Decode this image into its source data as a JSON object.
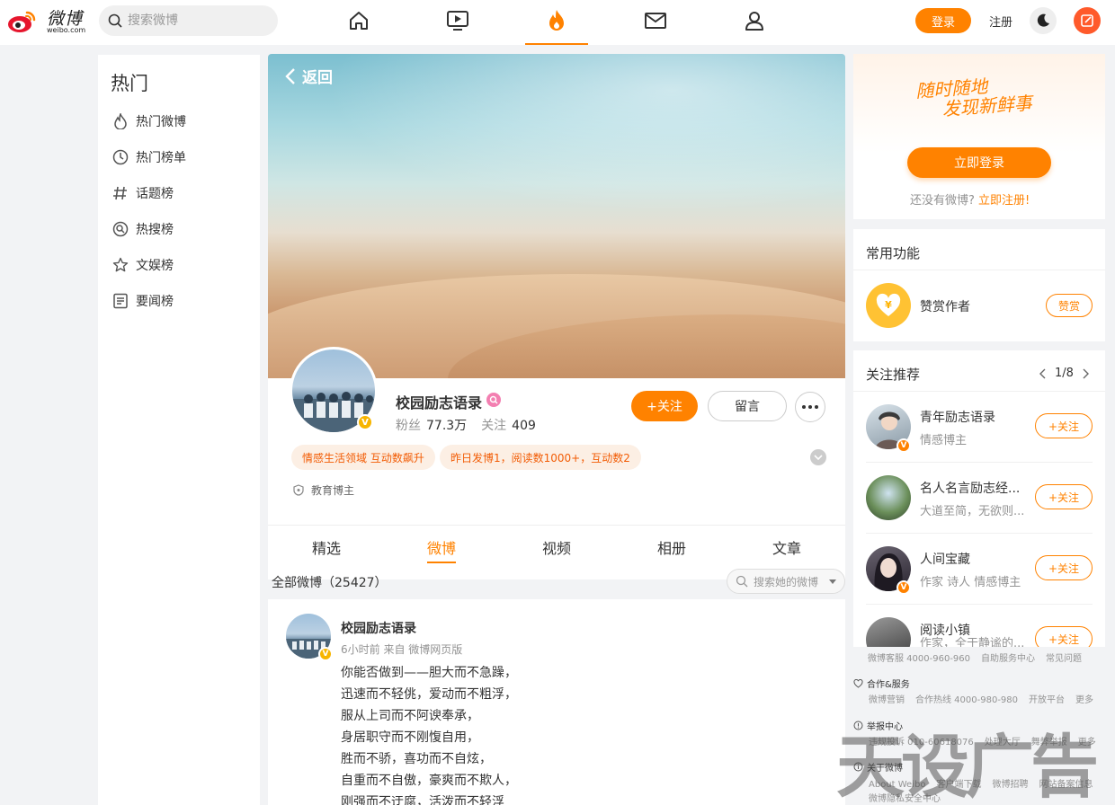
{
  "logo": {
    "name": "微博",
    "sub": "weibo.com"
  },
  "search": {
    "placeholder": "搜索微博"
  },
  "top_nav": [
    "home-icon",
    "video-icon",
    "hot-fire-icon",
    "message-icon",
    "user-icon"
  ],
  "header": {
    "login": "登录",
    "register": "注册"
  },
  "left_nav": {
    "title": "热门",
    "items": [
      {
        "label": "热门微博",
        "icon": "fire-icon"
      },
      {
        "label": "热门榜单",
        "icon": "clock-icon"
      },
      {
        "label": "话题榜",
        "icon": "hashtag-icon"
      },
      {
        "label": "热搜榜",
        "icon": "search-rank-icon"
      },
      {
        "label": "文娱榜",
        "icon": "star-icon"
      },
      {
        "label": "要闻榜",
        "icon": "news-icon"
      }
    ]
  },
  "profile": {
    "back": "返回",
    "name": "校园励志语录",
    "fans_label": "粉丝",
    "fans": "77.3万",
    "follow_label": "关注",
    "follow": "409",
    "follow_btn": "+关注",
    "message_btn": "留言",
    "tags": [
      "情感生活领域 互动数飙升",
      "昨日发博1，阅读数1000+，互动数2"
    ],
    "edu": "教育博主",
    "verify_badge": "V"
  },
  "tabs": [
    "精选",
    "微博",
    "视频",
    "相册",
    "文章"
  ],
  "active_tab": "微博",
  "feed": {
    "count_label": "全部微博（25427）",
    "search_placeholder": "搜索她的微博"
  },
  "post": {
    "name": "校园励志语录",
    "meta": "6小时前 来自 微博网页版",
    "lines": [
      "你能否做到——胆大而不急躁，",
      "迅速而不轻佻，爱动而不粗浮，",
      "服从上司而不阿谀奉承，",
      "身居职守而不刚愎自用，",
      "胜而不骄，喜功而不自炫，",
      "自重而不自傲，豪爽而不欺人，",
      "刚强而不迂腐，活泼而不轻浮"
    ]
  },
  "login_card": {
    "slogan_1": "随时随地",
    "slogan_2": "发现新鲜事",
    "login_now": "立即登录",
    "no_account": "还没有微博?",
    "register_now": "立即注册!"
  },
  "functions": {
    "title": "常用功能",
    "reward_label": "赞赏作者",
    "reward_btn": "赞赏"
  },
  "recommend": {
    "title": "关注推荐",
    "page": "1/8",
    "follow_btn": "+关注",
    "items": [
      {
        "name": "青年励志语录",
        "desc": "情感博主"
      },
      {
        "name": "名人名言励志经...",
        "desc": "大道至简，无欲则..."
      },
      {
        "name": "人间宝藏",
        "desc": "作家 诗人 情感博主"
      },
      {
        "name": "阅读小镇",
        "desc": "作家，全于静谧的..."
      }
    ]
  },
  "footer": {
    "customer": [
      "微博客服 4000-960-960",
      "自助服务中心",
      "常见问题"
    ],
    "coop_title": "合作&服务",
    "coop": [
      "微博营销",
      "合作热线 4000-980-980",
      "开放平台",
      "更多"
    ],
    "report_title": "举报中心",
    "report": [
      "违规投诉 010-60618076",
      "处理大厅",
      "舞弊举报",
      "更多"
    ],
    "about_title": "关于微博",
    "about": [
      "About Weibo",
      "客户端下载",
      "微博招聘",
      "网站备案信息"
    ],
    "privacy": "微博隐私安全中心"
  },
  "watermark": "天设广告",
  "colors": {
    "accent": "#ff8200",
    "tag_bg": "#fcefe4",
    "tag_text": "#f25c05"
  }
}
